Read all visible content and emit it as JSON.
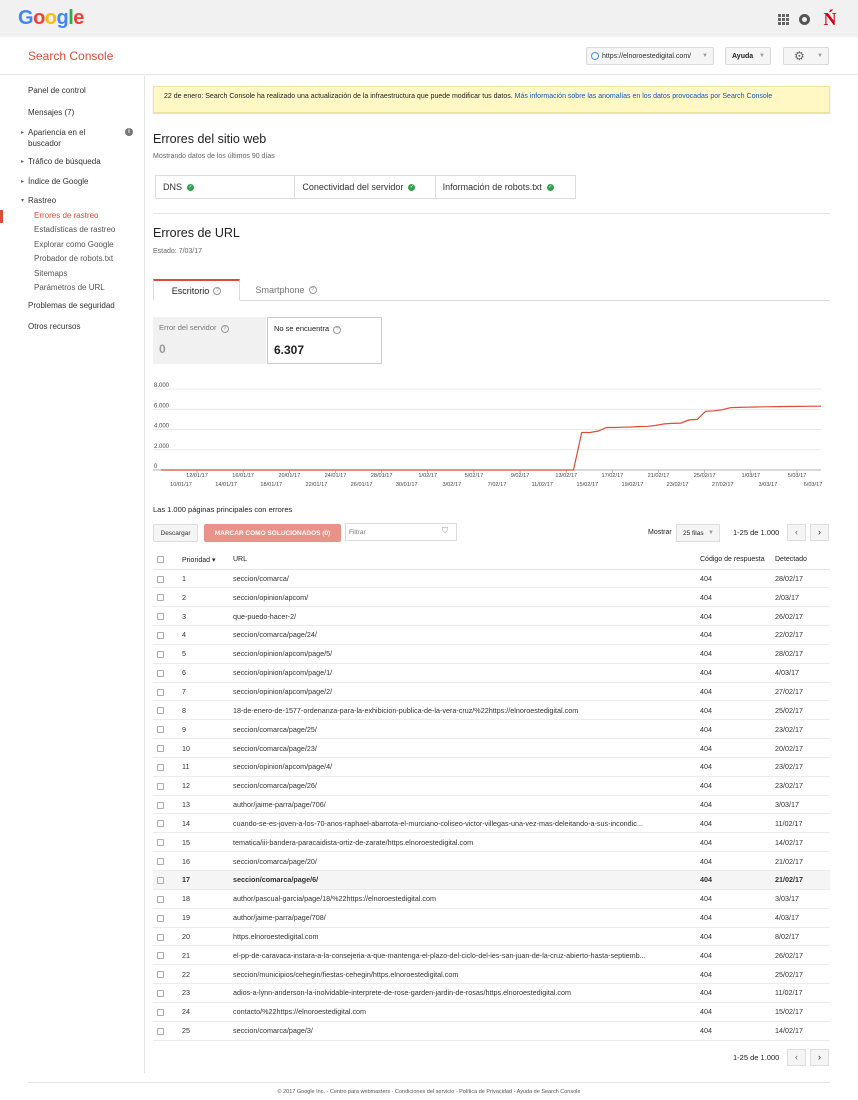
{
  "header": {
    "logo_letters": [
      {
        "ch": "G",
        "color": "#4285F4"
      },
      {
        "ch": "o",
        "color": "#EA4335"
      },
      {
        "ch": "o",
        "color": "#FBBC05"
      },
      {
        "ch": "g",
        "color": "#4285F4"
      },
      {
        "ch": "l",
        "color": "#34A853"
      },
      {
        "ch": "e",
        "color": "#EA4335"
      }
    ],
    "icons": [
      "apps-icon",
      "notifications-icon",
      "account-brand-icon"
    ],
    "brand_letter": "Ń"
  },
  "subheader": {
    "title": "Search Console",
    "site": "https://elnoroestedigital.com/",
    "help": "Ayuda"
  },
  "sidebar": {
    "items": [
      {
        "label": "Panel de control"
      },
      {
        "label": "Mensajes (7)"
      },
      {
        "label": "Apariencia en el"
      },
      {
        "label": "buscador"
      },
      {
        "label": "Tráfico de búsqueda"
      },
      {
        "label": "Índice de Google"
      },
      {
        "label": "Rastreo"
      },
      {
        "label": "Problemas de seguridad"
      },
      {
        "label": "Otros recursos"
      }
    ],
    "sub_items": [
      {
        "label": "Errores de rastreo"
      },
      {
        "label": "Estadísticas de rastreo"
      },
      {
        "label": "Explorar como Google"
      },
      {
        "label": "Probador de robots.txt"
      },
      {
        "label": "Sitemaps"
      },
      {
        "label": "Parámetros de URL"
      }
    ]
  },
  "notice": {
    "text": "22 de enero: Search Console ha realizado una actualización de la infraestructura que puede modificar tus datos. ",
    "link": "Más información sobre las anomalías en los datos provocadas por Search Console"
  },
  "site_errors": {
    "title": "Errores del sitio web",
    "subtitle": "Mostrando datos de los últimos 90 días",
    "checks": [
      "DNS",
      "Conectividad del servidor",
      "Información de robots.txt"
    ]
  },
  "url_errors": {
    "title": "Errores de URL",
    "status": "Estado: 7/03/17",
    "tabs": [
      "Escritorio",
      "Smartphone"
    ],
    "metrics": [
      {
        "label": "Error del servidor",
        "value": "0"
      },
      {
        "label": "No se encuentra",
        "value": "6.307"
      }
    ]
  },
  "chart_data": {
    "type": "line",
    "yticks": [
      "8.000",
      "6.000",
      "4.000",
      "2.000",
      "0"
    ],
    "ylim": [
      0,
      8000
    ],
    "x_labels_top": [
      "12/01/17",
      "16/01/17",
      "20/01/17",
      "24/01/17",
      "28/01/17",
      "1/02/17",
      "5/02/17",
      "9/02/17",
      "13/02/17",
      "17/02/17",
      "21/02/17",
      "25/02/17",
      "1/03/17",
      "5/03/17"
    ],
    "x_labels_bottom": [
      "10/01/17",
      "14/01/17",
      "18/01/17",
      "22/01/17",
      "26/01/17",
      "30/01/17",
      "3/02/17",
      "7/02/17",
      "11/02/17",
      "15/02/17",
      "19/02/17",
      "23/02/17",
      "27/02/17",
      "3/03/17",
      "6/03/17"
    ],
    "series": [
      {
        "color": "#dd4b39",
        "points": [
          [
            0,
            0
          ],
          [
            50,
            0
          ],
          [
            51,
            3700
          ],
          [
            52,
            3700
          ],
          [
            53,
            3850
          ],
          [
            54,
            4200
          ],
          [
            55,
            4200
          ],
          [
            56,
            4230
          ],
          [
            57,
            4250
          ],
          [
            58,
            4300
          ],
          [
            59,
            4320
          ],
          [
            60,
            4400
          ],
          [
            61,
            4550
          ],
          [
            62,
            4600
          ],
          [
            63,
            4630
          ],
          [
            64,
            4950
          ],
          [
            65,
            5000
          ],
          [
            66,
            5800
          ],
          [
            67,
            5850
          ],
          [
            68,
            5950
          ],
          [
            69,
            6150
          ],
          [
            70,
            6180
          ],
          [
            71,
            6200
          ],
          [
            72,
            6220
          ],
          [
            73,
            6240
          ],
          [
            74,
            6250
          ],
          [
            75,
            6260
          ],
          [
            76,
            6270
          ],
          [
            77,
            6280
          ],
          [
            78,
            6290
          ],
          [
            79,
            6300
          ],
          [
            80,
            6300
          ]
        ]
      }
    ]
  },
  "table": {
    "title": "Las 1.000 páginas principales con errores",
    "download": "Descargar",
    "mark": "MARCAR COMO SOLUCIONADOS (0)",
    "filter_placeholder": "Filtrar",
    "show": "Mostrar",
    "rows_per_page": "25 filas",
    "page_info": "1-25 de 1.000",
    "headers": {
      "priority": "Prioridad",
      "url": "URL",
      "code": "Código de respuesta",
      "detected": "Detectado"
    },
    "rows": [
      {
        "p": "1",
        "url": "seccion/comarca/",
        "code": "404",
        "date": "28/02/17"
      },
      {
        "p": "2",
        "url": "seccion/opinion/apcom/",
        "code": "404",
        "date": "2/03/17"
      },
      {
        "p": "3",
        "url": "que-puedo-hacer-2/",
        "code": "404",
        "date": "26/02/17"
      },
      {
        "p": "4",
        "url": "seccion/comarca/page/24/",
        "code": "404",
        "date": "22/02/17"
      },
      {
        "p": "5",
        "url": "seccion/opinion/apcom/page/5/",
        "code": "404",
        "date": "28/02/17"
      },
      {
        "p": "6",
        "url": "seccion/opinion/apcom/page/1/",
        "code": "404",
        "date": "4/03/17"
      },
      {
        "p": "7",
        "url": "seccion/opinion/apcom/page/2/",
        "code": "404",
        "date": "27/02/17"
      },
      {
        "p": "8",
        "url": "18-de-enero-de-1577-ordenanza-para-la-exhibicion-publica-de-la-vera-cruz/%22https://elnoroestedigital.com",
        "code": "404",
        "date": "25/02/17"
      },
      {
        "p": "9",
        "url": "seccion/comarca/page/25/",
        "code": "404",
        "date": "23/02/17"
      },
      {
        "p": "10",
        "url": "seccion/comarca/page/23/",
        "code": "404",
        "date": "20/02/17"
      },
      {
        "p": "11",
        "url": "seccion/opinion/apcom/page/4/",
        "code": "404",
        "date": "23/02/17"
      },
      {
        "p": "12",
        "url": "seccion/comarca/page/26/",
        "code": "404",
        "date": "23/02/17"
      },
      {
        "p": "13",
        "url": "author/jaime-parra/page/706/",
        "code": "404",
        "date": "3/03/17"
      },
      {
        "p": "14",
        "url": "cuando-se-es-joven-a-los-70-anos-raphael-abarrota-el-murciano-coliseo-victor-villegas-una-vez-mas-deleitando-a-sus-incondic...",
        "code": "404",
        "date": "11/02/17"
      },
      {
        "p": "15",
        "url": "tematica/iii-bandera-paracaidista-ortiz-de-zarate/https.elnoroestedigital.com",
        "code": "404",
        "date": "14/02/17"
      },
      {
        "p": "16",
        "url": "seccion/comarca/page/20/",
        "code": "404",
        "date": "21/02/17"
      },
      {
        "p": "17",
        "url": "seccion/comarca/page/6/",
        "code": "404",
        "date": "21/02/17"
      },
      {
        "p": "18",
        "url": "author/pascual-garcia/page/18/%22https://elnoroestedigital.com",
        "code": "404",
        "date": "3/03/17"
      },
      {
        "p": "19",
        "url": "author/jaime-parra/page/708/",
        "code": "404",
        "date": "4/03/17"
      },
      {
        "p": "20",
        "url": "https.elnoroestedigital.com",
        "code": "404",
        "date": "8/02/17"
      },
      {
        "p": "21",
        "url": "el-pp-de-caravaca-instara-a-la-consejeria-a-que-mantenga-el-plazo-del-ciclo-del-ies-san-juan-de-la-cruz-abierto-hasta-septiemb...",
        "code": "404",
        "date": "26/02/17"
      },
      {
        "p": "22",
        "url": "seccion/municipios/cehegin/fiestas-cehegin/https.elnoroestedigital.com",
        "code": "404",
        "date": "25/02/17"
      },
      {
        "p": "23",
        "url": "adios-a-lynn-anderson-la-inolvidable-interprete-de-rose-garden-jardin-de-rosas/https.elnoroestedigital.com",
        "code": "404",
        "date": "11/02/17"
      },
      {
        "p": "24",
        "url": "contacto/%22https://elnoroestedigital.com",
        "code": "404",
        "date": "15/02/17"
      },
      {
        "p": "25",
        "url": "seccion/comarca/page/3/",
        "code": "404",
        "date": "14/02/17"
      }
    ]
  },
  "footer": {
    "text": "© 2017 Google Inc. - Centro para webmasters - Condiciones del servicio - Política de Privacidad - Ayuda de Search Console"
  }
}
